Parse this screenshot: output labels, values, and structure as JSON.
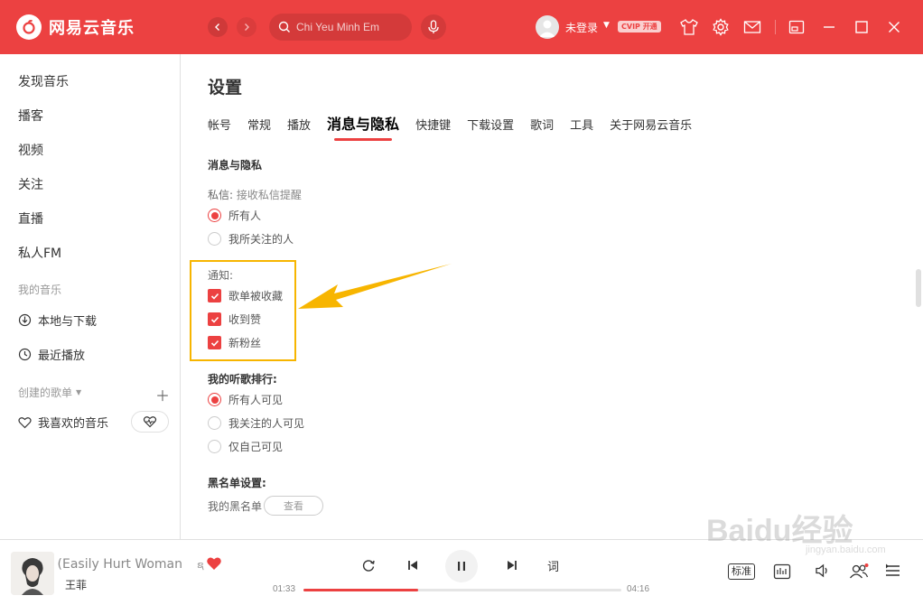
{
  "app": {
    "name": "网易云音乐",
    "accent": "#ec4141"
  },
  "header": {
    "search_placeholder": "Chi Yeu Minh Em",
    "user_label": "未登录",
    "vip_label": "CVIP 开通"
  },
  "sidebar": {
    "items": [
      "发现音乐",
      "播客",
      "视频",
      "关注",
      "直播",
      "私人FM"
    ],
    "my_music_title": "我的音乐",
    "local_download": "本地与下载",
    "recent_play": "最近播放",
    "created_playlists_title": "创建的歌单",
    "liked_music": "我喜欢的音乐"
  },
  "settings": {
    "title": "设置",
    "tabs": [
      "帐号",
      "常规",
      "播放",
      "消息与隐私",
      "快捷键",
      "下载设置",
      "歌词",
      "工具",
      "关于网易云音乐"
    ],
    "active_tab": "消息与隐私",
    "section_title": "消息与隐私",
    "dm_label": "私信:",
    "dm_hint": "接收私信提醒",
    "dm_options": [
      "所有人",
      "我所关注的人"
    ],
    "dm_selected": "所有人",
    "notify_label": "通知:",
    "notify_options": [
      "歌单被收藏",
      "收到赞",
      "新粉丝"
    ],
    "rank_label": "我的听歌排行:",
    "rank_options": [
      "所有人可见",
      "我关注的人可见",
      "仅自己可见"
    ],
    "rank_selected": "所有人可见",
    "blacklist_label": "黑名单设置:",
    "blacklist_text": "我的黑名单",
    "view_button": "查看"
  },
  "player": {
    "song_title": "Easily Hurt Woman)",
    "song_badge": "ຊ",
    "artist": "王菲",
    "current_time": "01:33",
    "total_time": "04:16",
    "progress": 0.36,
    "lyric_button": "词",
    "quality": "标准"
  },
  "watermark": {
    "text": "Baidu经验",
    "sub": "jingyan.baidu.com"
  }
}
